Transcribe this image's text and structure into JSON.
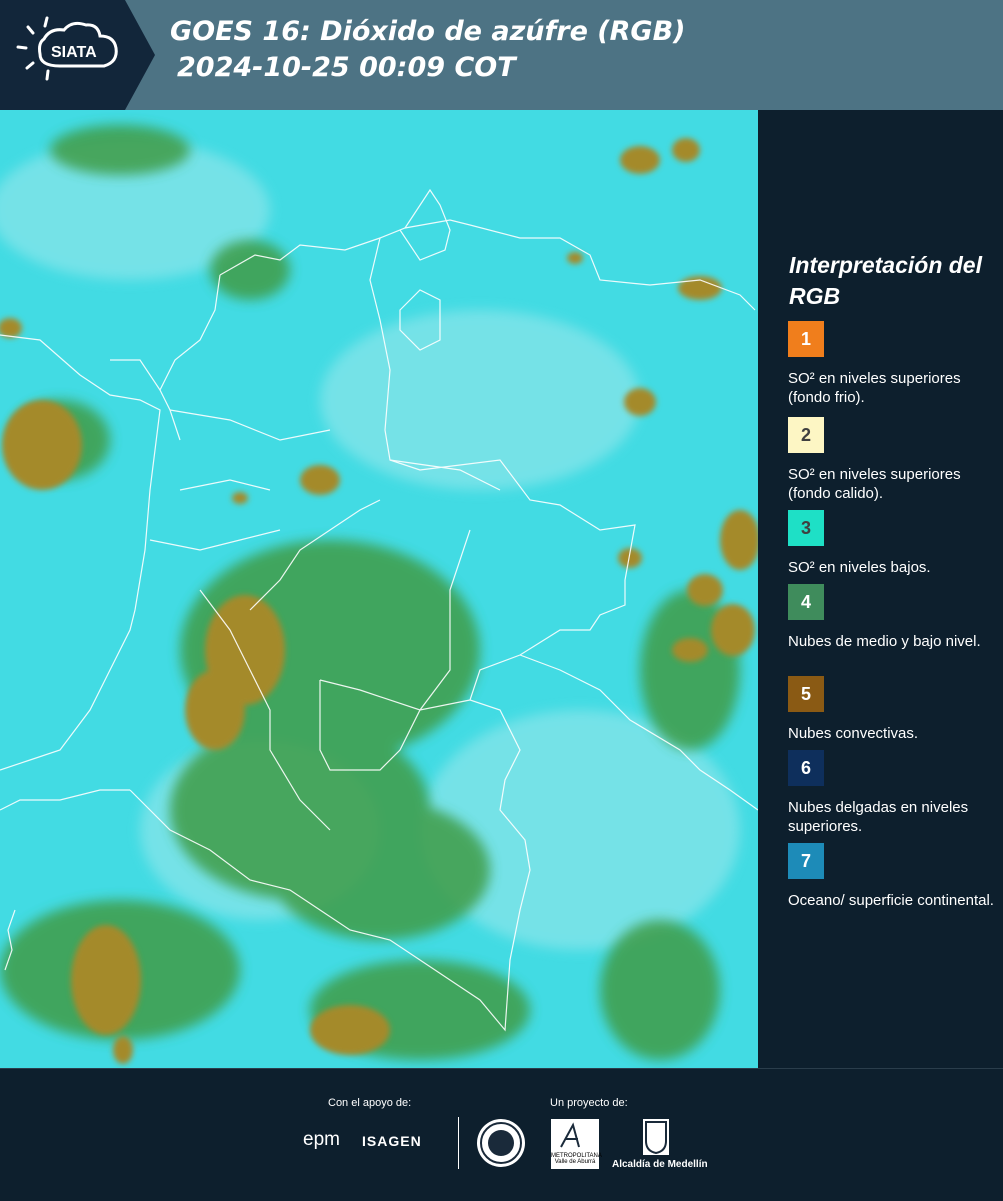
{
  "header": {
    "brand": "SIATA",
    "title_line1": "GOES 16: Dióxido de azúfre (RGB)",
    "title_line2": "2024-10-25 00:09 COT"
  },
  "map": {
    "description_colors": {
      "background": "#3fdbe4",
      "low_clouds": "#3a9a4a",
      "convective": "#a4872e"
    }
  },
  "legend": {
    "title": "Interpretación del RGB",
    "items": [
      {
        "number": "1",
        "color": "#f07e1c",
        "text": "SO² en niveles superiores (fondo frio)."
      },
      {
        "number": "2",
        "color": "#fdf6c4",
        "text": "SO² en niveles superiores (fondo calido)."
      },
      {
        "number": "3",
        "color": "#1ee0c6",
        "text": "SO² en niveles bajos."
      },
      {
        "number": "4",
        "color": "#3f8c5c",
        "text": "Nubes de medio y bajo nivel."
      },
      {
        "number": "5",
        "color": "#8a5a14",
        "text": "Nubes convectivas."
      },
      {
        "number": "6",
        "color": "#0e2f5c",
        "text": "Nubes delgadas en niveles superiores."
      },
      {
        "number": "7",
        "color": "#1d8bb8",
        "text": "Oceano/ superficie continental."
      }
    ]
  },
  "footer": {
    "support_label": "Con el apoyo de:",
    "project_label": "Un proyecto de:",
    "sponsor1": "epm",
    "sponsor2": "ISAGEN",
    "partner_area": "METROPOLITANA Valle de Aburrá",
    "partner_alcaldia": "Alcaldía de Medellín"
  }
}
